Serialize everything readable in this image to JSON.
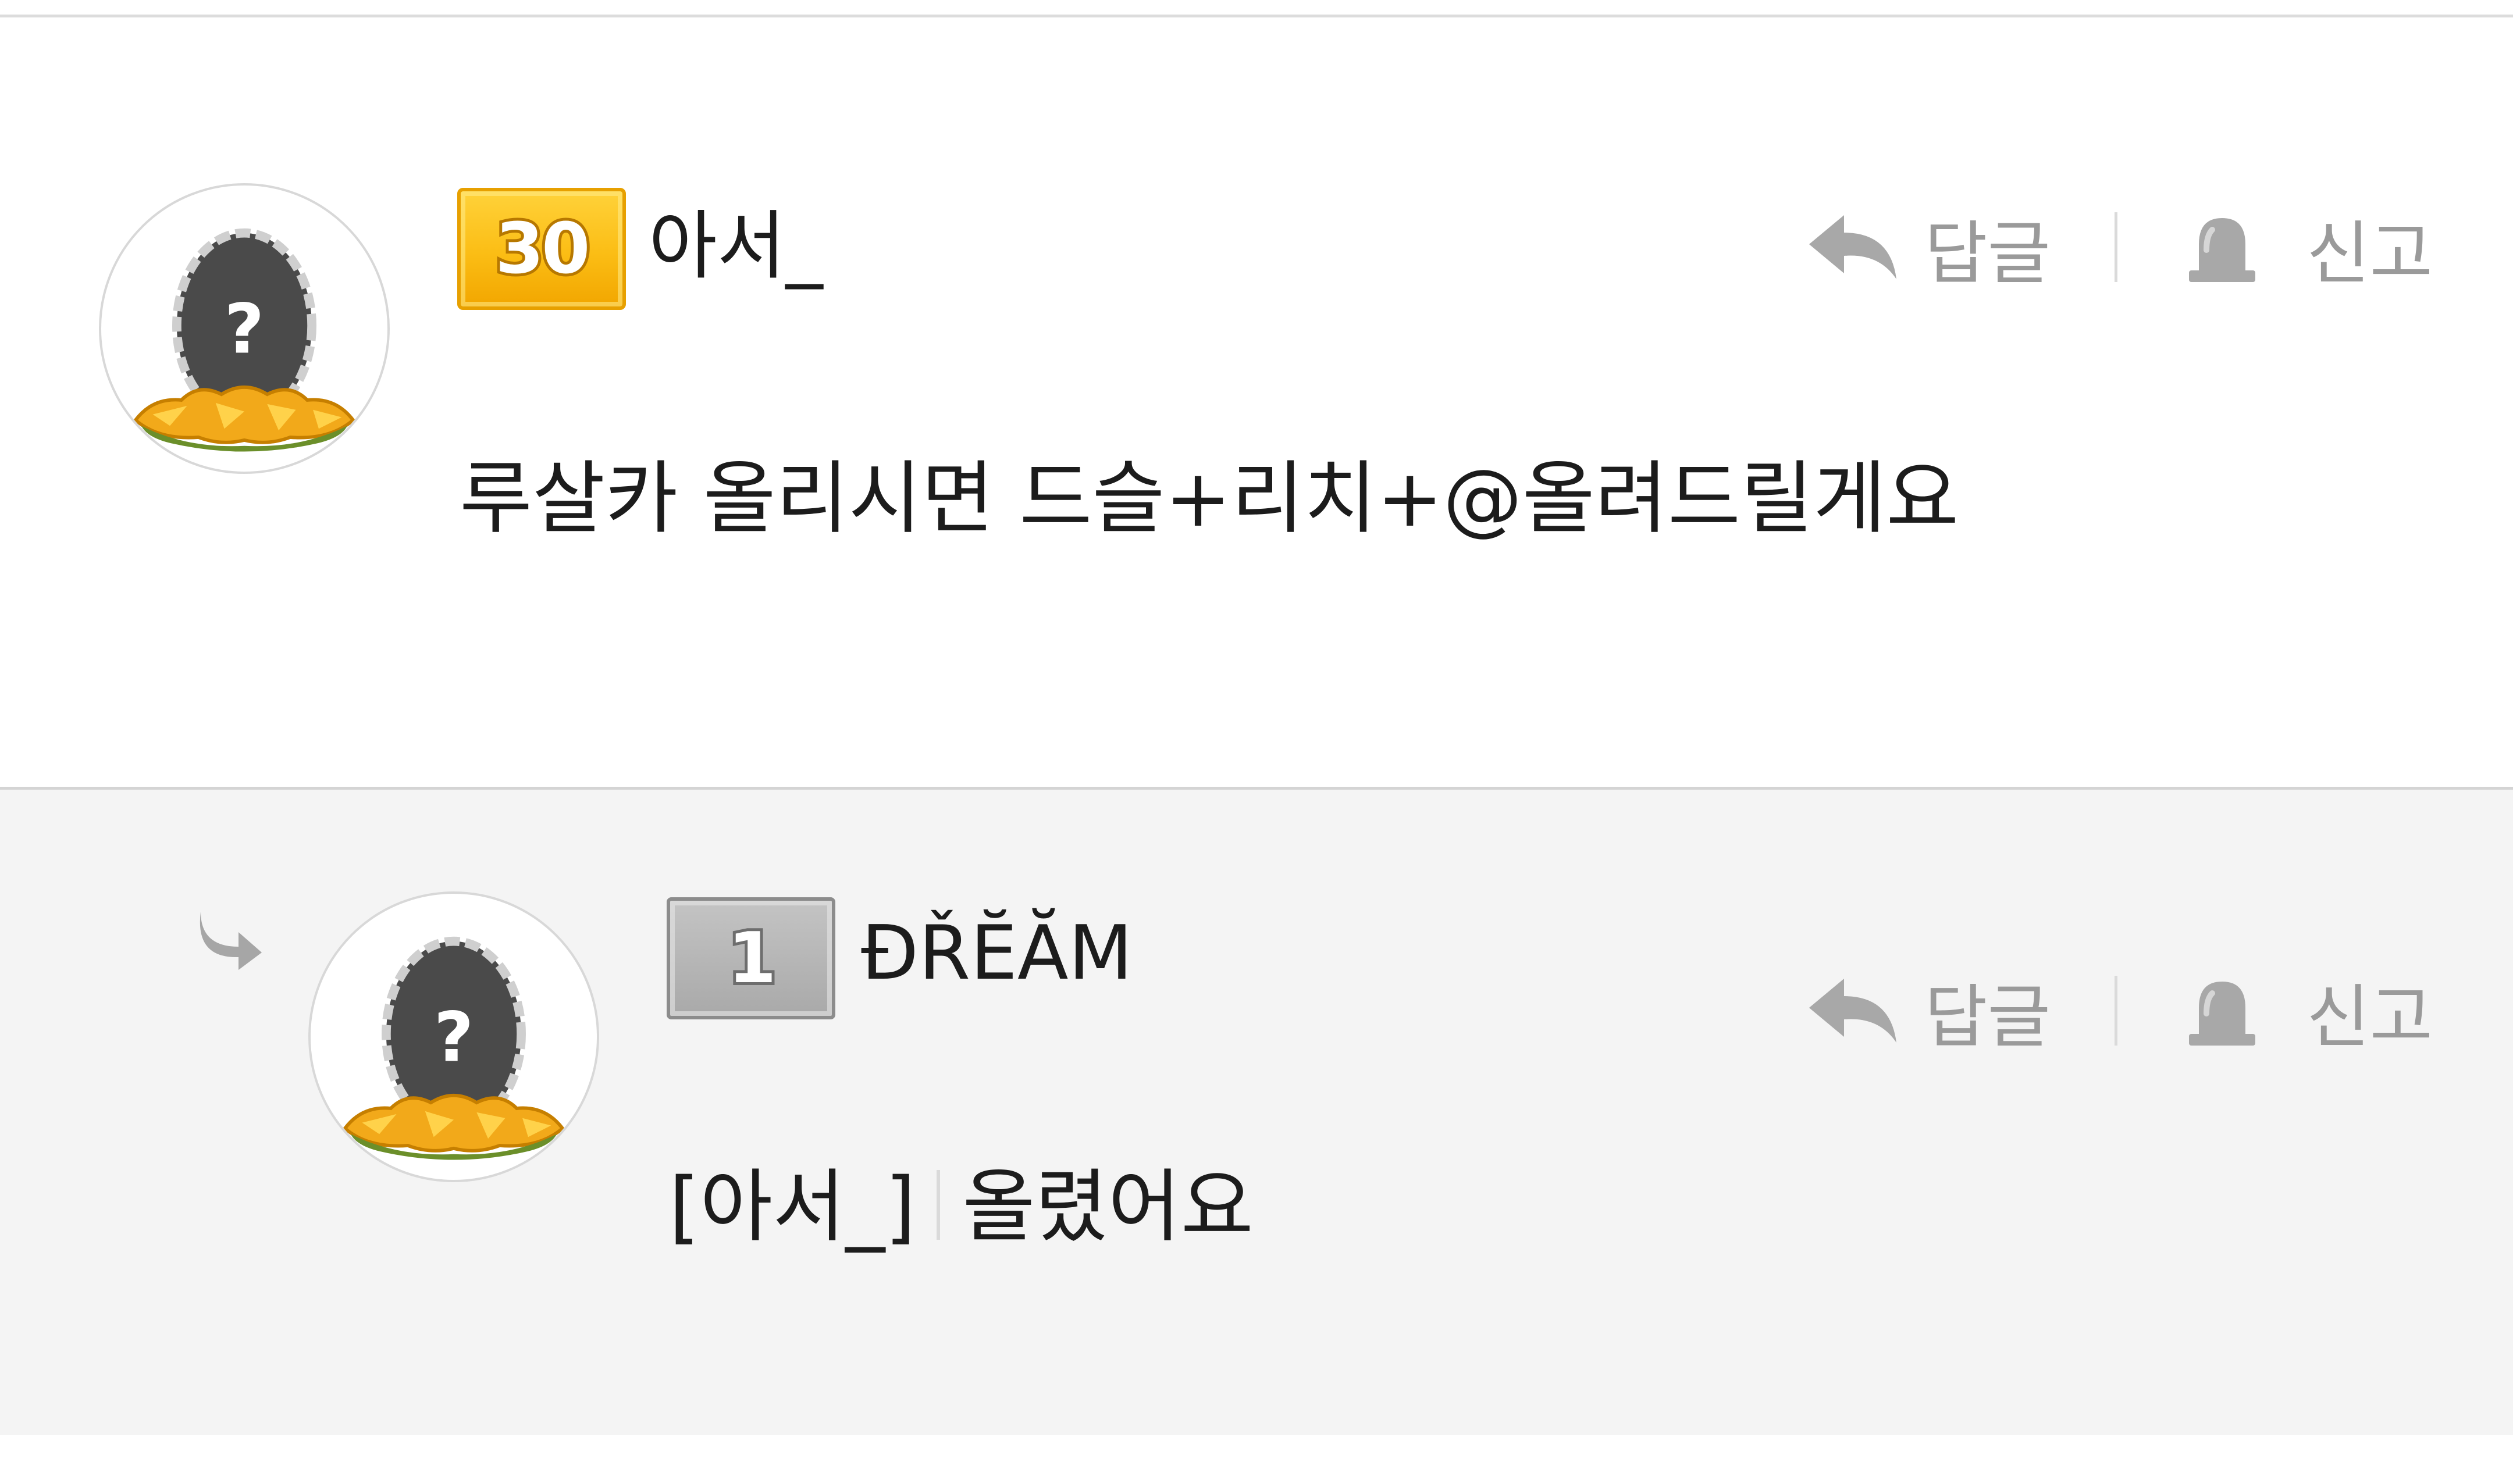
{
  "comments": [
    {
      "level": "30",
      "author": "아서_",
      "text": "루살카 올리시면 드슬+리치+@올려드릴게요",
      "reply_label": "답글",
      "report_label": "신고"
    },
    {
      "level": "1",
      "author": "ĐŘĔĂM",
      "mention": "[아서_]",
      "text": "올렸어요",
      "reply_label": "답글",
      "report_label": "신고"
    }
  ],
  "icons": {
    "reply": "reply-arrow-icon",
    "report": "siren-icon",
    "reply_indicator": "reply-indicator-arrow-icon",
    "avatar": "mystery-egg-in-nest"
  },
  "colors": {
    "level_gold": "#fbbd14",
    "level_gray": "#a9a9a9",
    "action_text": "#9a9a9a",
    "reply_background": "#f4f4f4",
    "egg": "#4a4a4a",
    "nest": "#f2a91a"
  }
}
